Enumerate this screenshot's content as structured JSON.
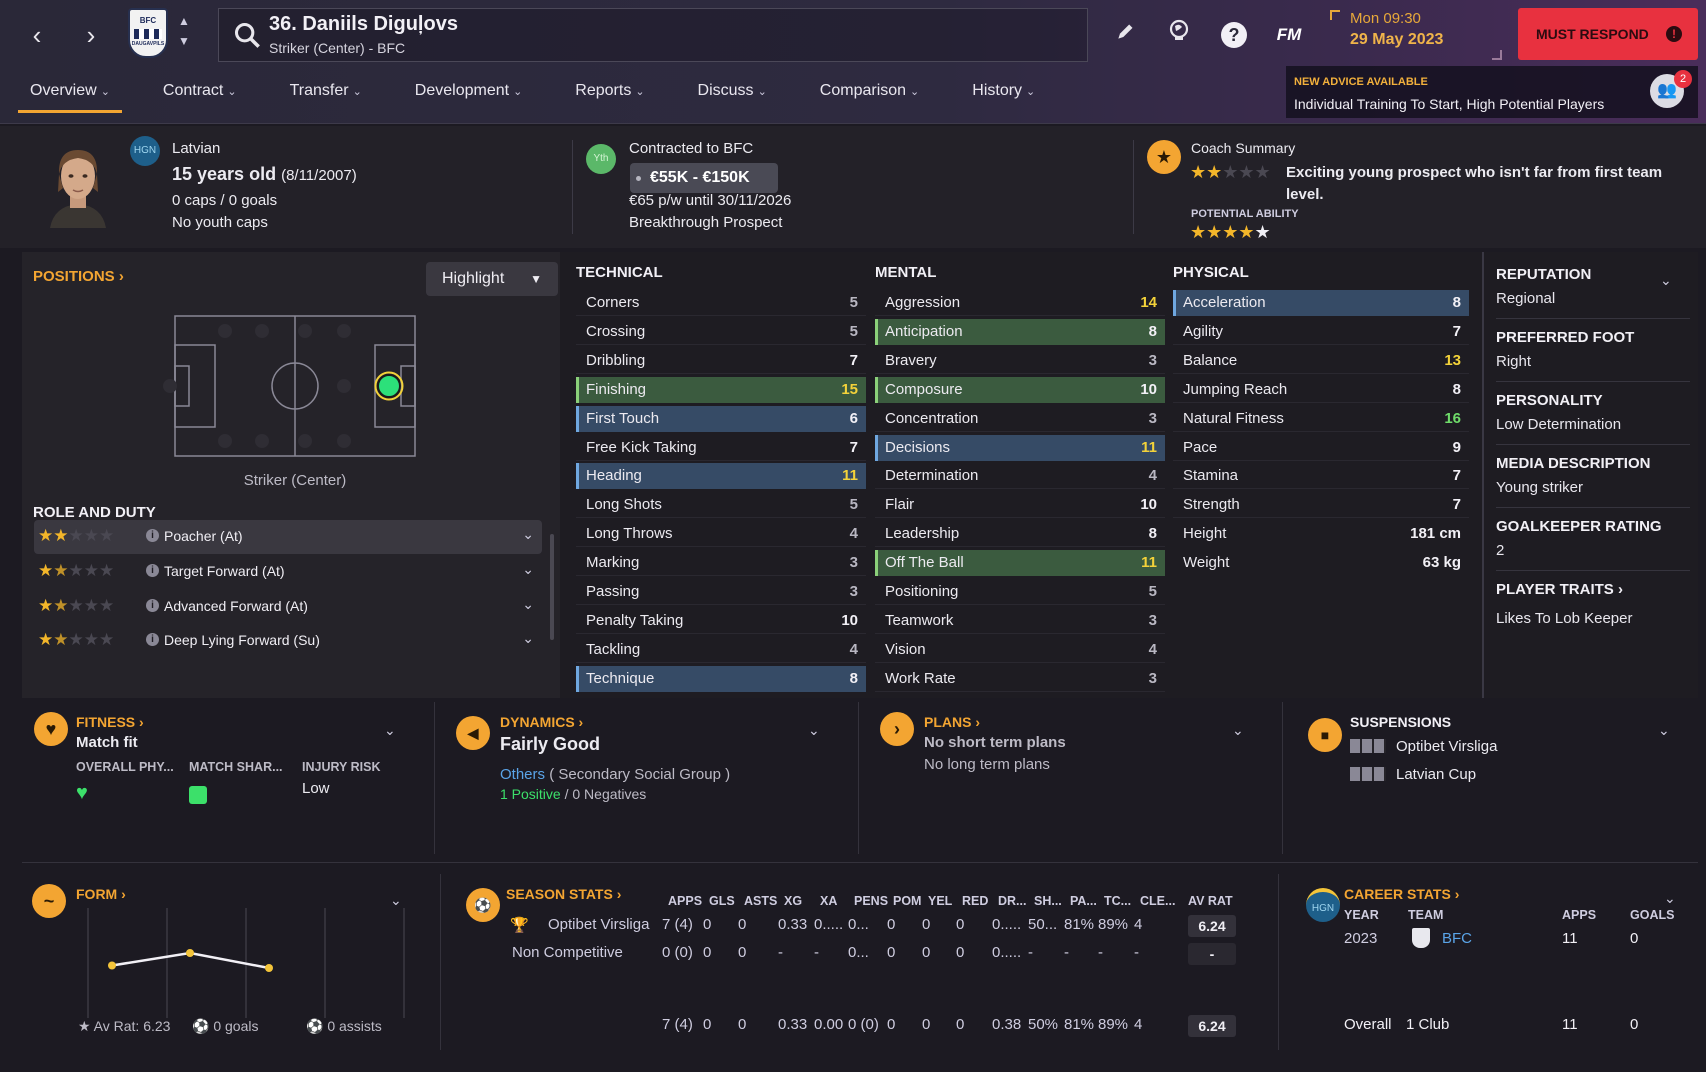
{
  "header": {
    "player_title": "36. Daniils Diguļovs",
    "player_subtitle": "Striker (Center) - BFC",
    "club_crest_text": "BFC",
    "club_crest_sub": "DAUGAVPILS",
    "fm_label": "FM",
    "date_day": "Mon 09:30",
    "date_full": "29 May 2023",
    "must_respond": "MUST RESPOND",
    "must_icon": "!",
    "icons": [
      "back-arrow-icon",
      "forward-arrow-icon",
      "search-icon",
      "pencil-icon",
      "globe-icon",
      "help-icon"
    ]
  },
  "tabs": [
    {
      "label": "Overview"
    },
    {
      "label": "Contract"
    },
    {
      "label": "Transfer"
    },
    {
      "label": "Development"
    },
    {
      "label": "Reports"
    },
    {
      "label": "Discuss"
    },
    {
      "label": "Comparison"
    },
    {
      "label": "History"
    }
  ],
  "advice": {
    "heading": "NEW ADVICE AVAILABLE",
    "text": "Individual Training To Start, High Potential Players",
    "badge": "2"
  },
  "profile": {
    "hgn": "HGN",
    "nationality": "Latvian",
    "age": "15 years old",
    "dob": "(8/11/2007)",
    "caps": "0 caps / 0 goals",
    "youth_caps": "No youth caps",
    "yth": "Yth",
    "contracted": "Contracted to BFC",
    "value_range": "€55K - €150K",
    "wage": "€65 p/w until 30/11/2026",
    "status": "Breakthrough Prospect",
    "coach_summary_label": "Coach Summary",
    "coach_summary": "Exciting young prospect who isn't far from first team level.",
    "current_ability_stars": 2,
    "potential_label": "POTENTIAL ABILITY",
    "potential_ability_stars": 4.5
  },
  "positions": {
    "heading": "POSITIONS",
    "highlight_label": "Highlight",
    "position_name": "Striker (Center)",
    "role_heading": "ROLE AND DUTY",
    "roles": [
      {
        "name": "Poacher (At)",
        "stars": 2
      },
      {
        "name": "Target Forward (At)",
        "stars": 1.5
      },
      {
        "name": "Advanced Forward (At)",
        "stars": 1.5
      },
      {
        "name": "Deep Lying Forward (Su)",
        "stars": 1.5
      }
    ]
  },
  "attributes": {
    "technical_label": "TECHNICAL",
    "mental_label": "MENTAL",
    "physical_label": "PHYSICAL",
    "technical": [
      {
        "name": "Corners",
        "value": "5",
        "hl": "plain"
      },
      {
        "name": "Crossing",
        "value": "5",
        "hl": "plain"
      },
      {
        "name": "Dribbling",
        "value": "7",
        "hl": "plain"
      },
      {
        "name": "Finishing",
        "value": "15",
        "hl": "green"
      },
      {
        "name": "First Touch",
        "value": "6",
        "hl": "blue"
      },
      {
        "name": "Free Kick Taking",
        "value": "7",
        "hl": "plain"
      },
      {
        "name": "Heading",
        "value": "11",
        "hl": "blue"
      },
      {
        "name": "Long Shots",
        "value": "5",
        "hl": "plain"
      },
      {
        "name": "Long Throws",
        "value": "4",
        "hl": "plain"
      },
      {
        "name": "Marking",
        "value": "3",
        "hl": "plain"
      },
      {
        "name": "Passing",
        "value": "3",
        "hl": "plain"
      },
      {
        "name": "Penalty Taking",
        "value": "10",
        "hl": "plain"
      },
      {
        "name": "Tackling",
        "value": "4",
        "hl": "plain"
      },
      {
        "name": "Technique",
        "value": "8",
        "hl": "blue"
      }
    ],
    "mental": [
      {
        "name": "Aggression",
        "value": "14",
        "hl": "plain"
      },
      {
        "name": "Anticipation",
        "value": "8",
        "hl": "green"
      },
      {
        "name": "Bravery",
        "value": "3",
        "hl": "plain"
      },
      {
        "name": "Composure",
        "value": "10",
        "hl": "green"
      },
      {
        "name": "Concentration",
        "value": "3",
        "hl": "plain"
      },
      {
        "name": "Decisions",
        "value": "11",
        "hl": "blue"
      },
      {
        "name": "Determination",
        "value": "4",
        "hl": "plain"
      },
      {
        "name": "Flair",
        "value": "10",
        "hl": "plain"
      },
      {
        "name": "Leadership",
        "value": "8",
        "hl": "plain"
      },
      {
        "name": "Off The Ball",
        "value": "11",
        "hl": "green"
      },
      {
        "name": "Positioning",
        "value": "5",
        "hl": "plain"
      },
      {
        "name": "Teamwork",
        "value": "3",
        "hl": "plain"
      },
      {
        "name": "Vision",
        "value": "4",
        "hl": "plain"
      },
      {
        "name": "Work Rate",
        "value": "3",
        "hl": "plain"
      }
    ],
    "physical": [
      {
        "name": "Acceleration",
        "value": "8",
        "hl": "blue"
      },
      {
        "name": "Agility",
        "value": "7",
        "hl": "plain"
      },
      {
        "name": "Balance",
        "value": "13",
        "hl": "plain"
      },
      {
        "name": "Jumping Reach",
        "value": "8",
        "hl": "plain"
      },
      {
        "name": "Natural Fitness",
        "value": "16",
        "hl": "plain"
      },
      {
        "name": "Pace",
        "value": "9",
        "hl": "plain"
      },
      {
        "name": "Stamina",
        "value": "7",
        "hl": "plain"
      },
      {
        "name": "Strength",
        "value": "7",
        "hl": "plain"
      },
      {
        "name": "Height",
        "value": "181 cm",
        "hl": "plain"
      },
      {
        "name": "Weight",
        "value": "63 kg",
        "hl": "plain"
      }
    ],
    "value_colors": {
      "high": "#f3d23a",
      "green": "#6fdc6a",
      "normal": "#f2f0f6"
    }
  },
  "info": {
    "reputation_h": "REPUTATION",
    "reputation": "Regional",
    "foot_h": "PREFERRED FOOT",
    "foot": "Right",
    "personality_h": "PERSONALITY",
    "personality": "Low Determination",
    "media_h": "MEDIA DESCRIPTION",
    "media": "Young striker",
    "gk_h": "GOALKEEPER RATING",
    "gk": "2",
    "traits_h": "PLAYER TRAITS",
    "traits": "Likes To Lob Keeper"
  },
  "fitness": {
    "heading": "FITNESS",
    "status": "Match fit",
    "col1": "OVERALL PHY...",
    "col2": "MATCH SHAR...",
    "col3": "INJURY RISK",
    "injury": "Low"
  },
  "dynamics": {
    "heading": "DYNAMICS",
    "status": "Fairly Good",
    "group_link": "Others",
    "group_text": "( Secondary Social Group )",
    "positive": "1 Positive",
    "slash": "/",
    "negative": "0 Negatives"
  },
  "plans": {
    "heading": "PLANS",
    "short": "No short term plans",
    "long": "No long term plans"
  },
  "suspensions": {
    "heading": "SUSPENSIONS",
    "items": [
      "Optibet Virsliga",
      "Latvian Cup"
    ]
  },
  "form": {
    "heading": "FORM",
    "av_rat": "Av Rat: 6.23",
    "goals": "0 goals",
    "assists": "0 assists",
    "points": [
      6.25,
      6.3,
      6.24
    ]
  },
  "season": {
    "heading": "SEASON STATS",
    "columns": [
      "APPS",
      "GLS",
      "ASTS",
      "XG",
      "XA",
      "PENS",
      "POM",
      "YEL",
      "RED",
      "DR...",
      "SH...",
      "PA...",
      "TC...",
      "CLE...",
      "AV RAT"
    ],
    "rows": [
      {
        "comp": "Optibet Virsliga",
        "vals": [
          "7 (4)",
          "0",
          "0",
          "0.33",
          "0.....",
          "0...",
          "0",
          "0",
          "0",
          "0.....",
          "50...",
          "81%",
          "89%",
          "4"
        ],
        "rat": "6.24"
      },
      {
        "comp": "Non Competitive",
        "vals": [
          "0 (0)",
          "0",
          "0",
          "-",
          "-",
          "0...",
          "0",
          "0",
          "0",
          "0.....",
          "-",
          "-",
          "-",
          "-"
        ],
        "rat": "-"
      }
    ],
    "total": {
      "vals": [
        "7 (4)",
        "0",
        "0",
        "0.33",
        "0.00",
        "0 (0)",
        "0",
        "0",
        "0",
        "0.38",
        "50%",
        "81%",
        "89%",
        "4"
      ],
      "rat": "6.24"
    }
  },
  "career": {
    "heading": "CAREER STATS",
    "hgn": "HGN",
    "year_h": "YEAR",
    "team_h": "TEAM",
    "apps_h": "APPS",
    "goals_h": "GOALS",
    "year": "2023",
    "team": "BFC",
    "apps": "11",
    "goals": "0",
    "overall": "Overall",
    "clubs": "1 Club",
    "overall_apps": "11",
    "overall_goals": "0"
  }
}
